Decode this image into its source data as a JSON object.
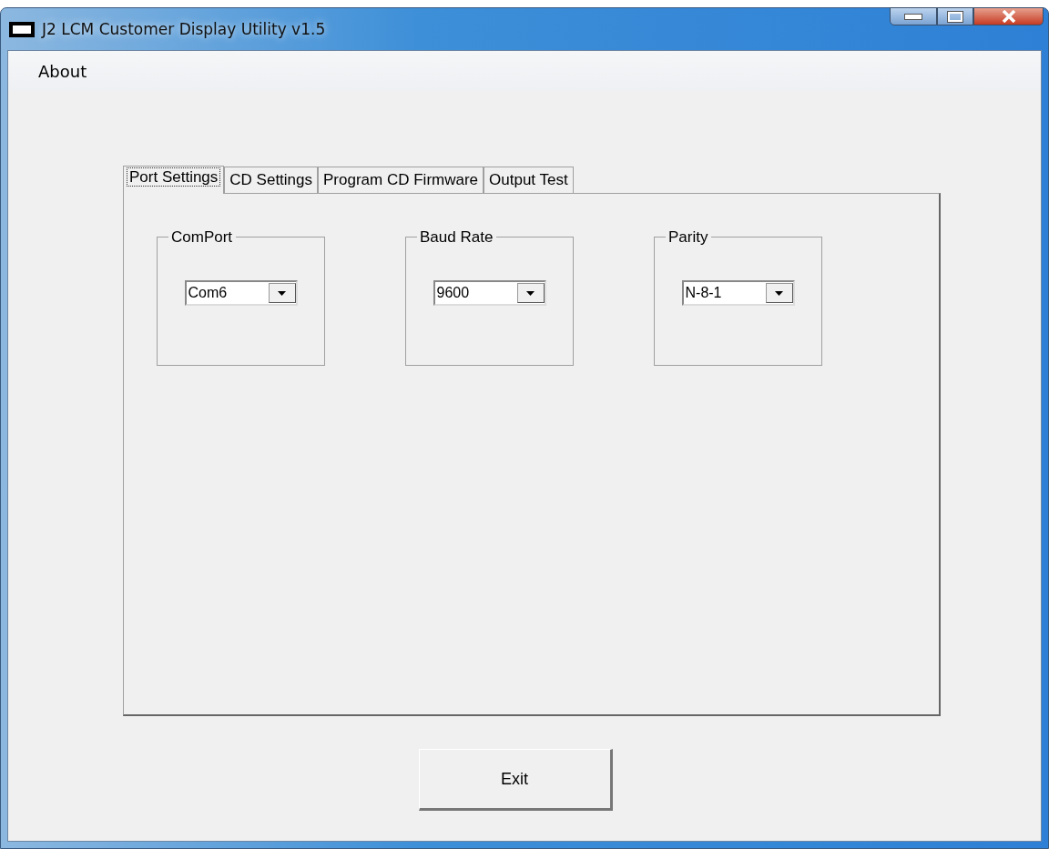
{
  "window": {
    "title": "J2 LCM Customer Display Utility v1.5"
  },
  "menu": [
    "About"
  ],
  "tabs": [
    {
      "label": "Port Settings",
      "selected": true
    },
    {
      "label": "CD Settings",
      "selected": false
    },
    {
      "label": "Program CD Firmware",
      "selected": false
    },
    {
      "label": "Output Test",
      "selected": false
    }
  ],
  "groups": [
    {
      "title": "ComPort",
      "value": "Com6"
    },
    {
      "title": "Baud Rate",
      "value": "9600"
    },
    {
      "title": "Parity",
      "value": "N-8-1"
    }
  ],
  "buttons": [
    "Exit"
  ]
}
